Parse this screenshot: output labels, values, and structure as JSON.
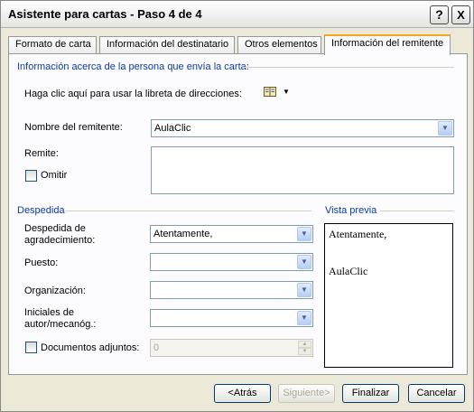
{
  "window": {
    "title": "Asistente para cartas - Paso 4 de 4",
    "help_glyph": "?",
    "close_glyph": "X"
  },
  "tabs": [
    {
      "label": "Formato de carta",
      "active": false
    },
    {
      "label": "Información del destinatario",
      "active": false
    },
    {
      "label": "Otros elementos",
      "active": false
    },
    {
      "label": "Información del remitente",
      "active": true
    }
  ],
  "sender_section": {
    "heading": "Información acerca de la persona que envía la carta:",
    "address_book_prefix": "Haga clic aquí para usar la libreta de direcciones:",
    "address_book_icon": "address-book-icon",
    "sender_name_label": "Nombre del remitente:",
    "sender_name_value": "AulaClic",
    "return_address_label": "Remite:",
    "return_address_value": "",
    "omit_label": "Omitir",
    "omit_checked": false
  },
  "closing_section": {
    "heading": "Despedida",
    "complimentary_closing_label_line1": "Despedida de",
    "complimentary_closing_label_line2": "agradecimiento:",
    "complimentary_closing_value": "Atentamente,",
    "job_title_label": "Puesto:",
    "job_title_value": "",
    "company_label": "Organización:",
    "company_value": "",
    "initials_label_line1": "Iniciales de",
    "initials_label_line2": "autor/mecanóg.:",
    "initials_value": "",
    "enclosures_label": "Documentos adjuntos:",
    "enclosures_checked": false,
    "enclosures_value": "0"
  },
  "preview": {
    "heading": "Vista previa",
    "closing_text": "Atentamente,",
    "name_text": "AulaClic"
  },
  "buttons": {
    "back": "<Atrás",
    "next": "Siguiente>",
    "finish": "Finalizar",
    "cancel": "Cancelar"
  }
}
